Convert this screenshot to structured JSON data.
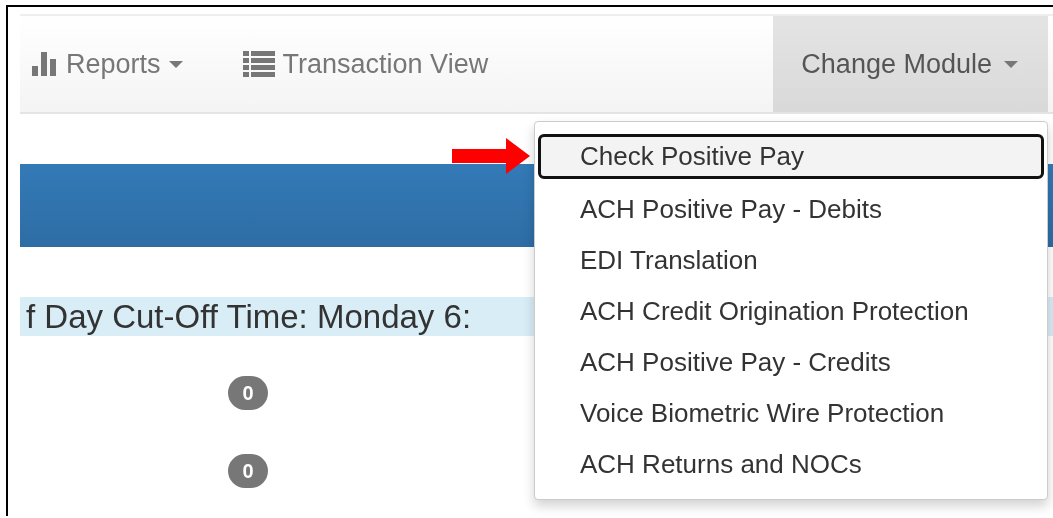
{
  "navbar": {
    "items": [
      {
        "label": "Reports",
        "kind": "dropdown"
      },
      {
        "label": "Transaction View",
        "kind": "link"
      }
    ],
    "module_button": {
      "label": "Change Module",
      "expanded": true
    }
  },
  "module_menu": {
    "items": [
      {
        "label": "Check Positive Pay",
        "selected": true
      },
      {
        "label": "ACH Positive Pay - Debits",
        "selected": false
      },
      {
        "label": "EDI Translation",
        "selected": false
      },
      {
        "label": "ACH Credit Origination Protection",
        "selected": false
      },
      {
        "label": "ACH Positive Pay - Credits",
        "selected": false
      },
      {
        "label": "Voice Biometric Wire Protection",
        "selected": false
      },
      {
        "label": "ACH Returns and NOCs",
        "selected": false
      }
    ]
  },
  "cutoff_text": "f Day Cut-Off Time: Monday 6:",
  "badges": [
    "0",
    "0"
  ]
}
